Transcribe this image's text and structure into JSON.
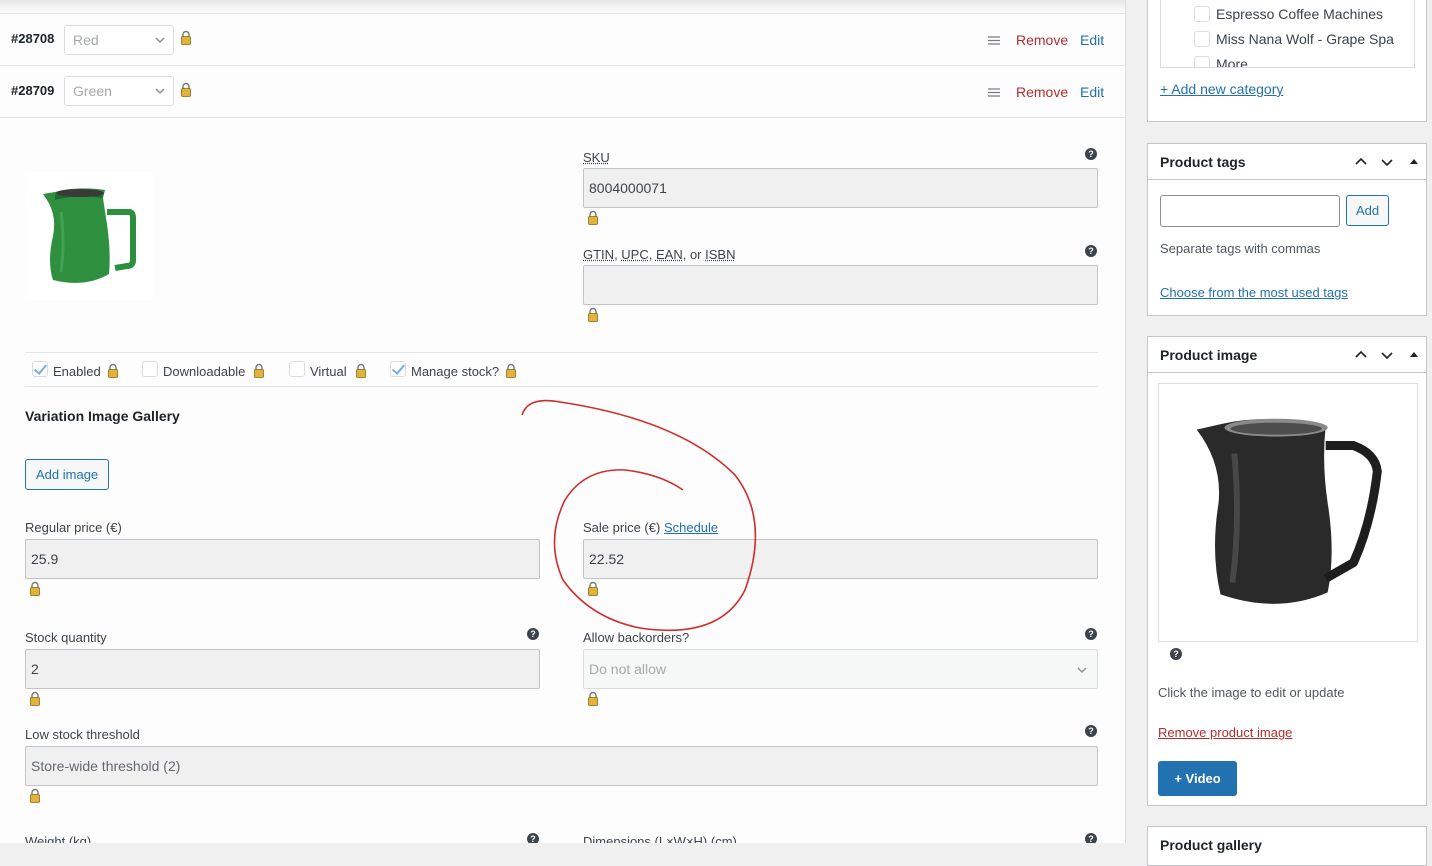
{
  "variations": [
    {
      "id": "#28708",
      "value": "Red",
      "remove": "Remove",
      "edit": "Edit"
    },
    {
      "id": "#28709",
      "value": "Green",
      "remove": "Remove",
      "edit": "Edit"
    }
  ],
  "variation": {
    "sku_label": "SKU",
    "sku_value": "8004000071",
    "gtin_label_parts": [
      "GTIN",
      "UPC",
      "EAN",
      "ISBN"
    ],
    "gtin_label_seps": [
      ", ",
      ", ",
      ", or "
    ],
    "gtin_value": "",
    "checkboxes": [
      {
        "label": "Enabled",
        "checked": true
      },
      {
        "label": "Downloadable",
        "checked": false
      },
      {
        "label": "Virtual",
        "checked": false
      },
      {
        "label": "Manage stock?",
        "checked": true
      }
    ],
    "gallery_title": "Variation Image Gallery",
    "add_image": "Add image",
    "regular_price_label": "Regular price (€)",
    "regular_price_value": "25.9",
    "sale_price_label": "Sale price (€)",
    "schedule_link": "Schedule",
    "sale_price_value": "22.52",
    "stock_qty_label": "Stock quantity",
    "stock_qty_value": "2",
    "backorders_label": "Allow backorders?",
    "backorders_value": "Do not allow",
    "low_stock_label": "Low stock threshold",
    "low_stock_placeholder": "Store-wide threshold (2)",
    "weight_label": "Weight (kg)",
    "dimensions_label": "Dimensions (L×W×H) (cm)"
  },
  "sidebar": {
    "categories": [
      "Espresso Coffee Machines",
      "Miss Nana Wolf - Grape Spa",
      "More"
    ],
    "add_category": "+ Add new category",
    "tags": {
      "title": "Product tags",
      "add_button": "Add",
      "hint": "Separate tags with commas",
      "choose_link": "Choose from the most used tags"
    },
    "image": {
      "title": "Product image",
      "hint": "Click the image to edit or update",
      "remove_link": "Remove product image",
      "video_button": "+ Video"
    },
    "next_panel_title": "Product gallery"
  },
  "colors": {
    "accent": "#2271b1",
    "danger": "#b32d2e",
    "annotation": "#d02c2c",
    "jug_green": "#2e8f3e",
    "jug_black": "#2a2a2a"
  }
}
